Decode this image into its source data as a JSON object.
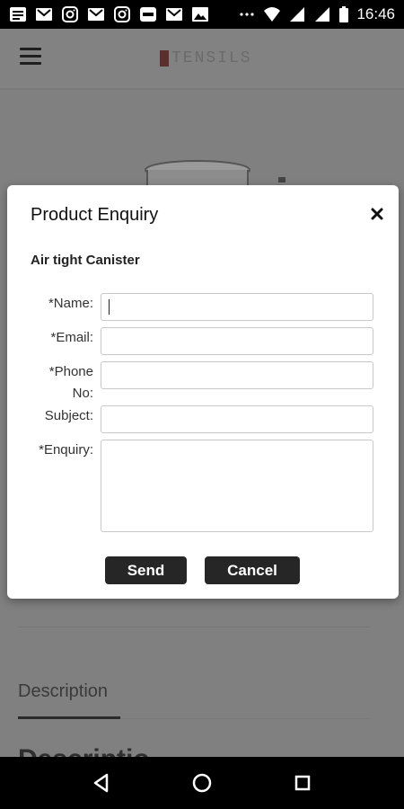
{
  "status_bar": {
    "time": "16:46",
    "icons": [
      "notification-icon",
      "gmail-icon",
      "instagram-icon",
      "gmail-icon",
      "instagram-icon",
      "app-icon",
      "gmail-icon",
      "image-icon",
      "more-icon",
      "wifi-icon",
      "signal-icon",
      "signal-icon",
      "battery-icon"
    ]
  },
  "app_bar": {
    "brand": "TENSILS"
  },
  "background": {
    "tab_label": "Description",
    "heading_fragment": "Descriptio"
  },
  "dialog": {
    "title": "Product Enquiry",
    "product_name": "Air tight Canister",
    "fields": {
      "name_label": "*Name:",
      "name_value": "",
      "email_label": "*Email:",
      "email_value": "",
      "phone_label_line1": "*Phone",
      "phone_label_line2": "No:",
      "phone_value": "",
      "subject_label": "Subject:",
      "subject_value": "",
      "enquiry_label": "*Enquiry:",
      "enquiry_value": ""
    },
    "send_label": "Send",
    "cancel_label": "Cancel"
  }
}
